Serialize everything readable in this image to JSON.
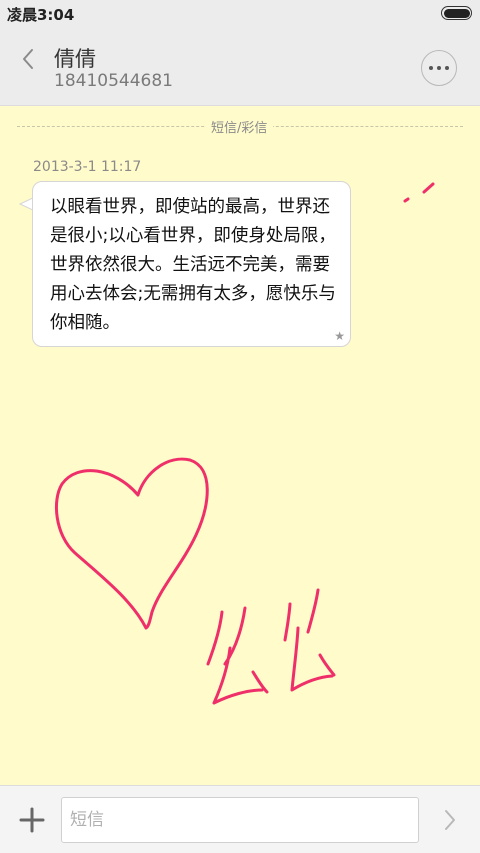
{
  "status_bar": {
    "time": "凌晨3:04"
  },
  "header": {
    "contact_name": "倩倩",
    "contact_number": "18410544681"
  },
  "conversation": {
    "divider_label": "短信/彩信",
    "messages": [
      {
        "timestamp": "2013-3-1 11:17",
        "text": "以眼看世界，即使站的最高，世界还是很小;以心看世界，即使身处局限，世界依然很大。生活远不完美，需要用心去体会;无需拥有太多，愿快乐与你相随。"
      }
    ]
  },
  "composer": {
    "placeholder": "短信"
  },
  "colors": {
    "background": "#fffbcb",
    "drawing": "#ef2f6a",
    "header": "#ececec"
  },
  "icons": {
    "back": "chevron-left-icon",
    "more": "more-dots-icon",
    "star": "star-icon",
    "add": "plus-icon",
    "send": "chevron-right-icon",
    "battery": "battery-icon"
  }
}
